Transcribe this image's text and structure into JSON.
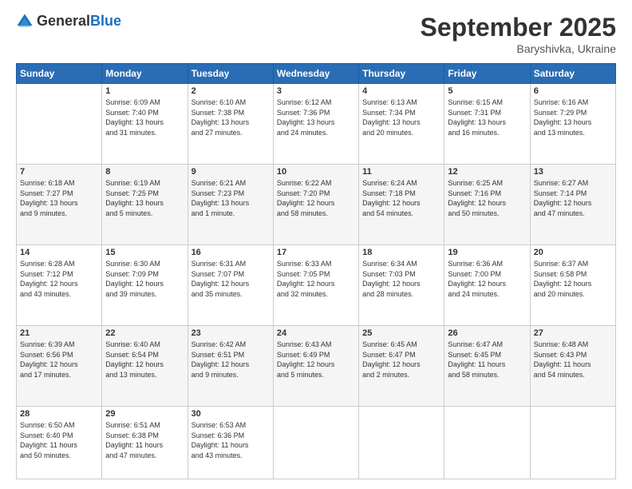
{
  "header": {
    "logo_general": "General",
    "logo_blue": "Blue",
    "month_title": "September 2025",
    "location": "Baryshivka, Ukraine"
  },
  "days_of_week": [
    "Sunday",
    "Monday",
    "Tuesday",
    "Wednesday",
    "Thursday",
    "Friday",
    "Saturday"
  ],
  "weeks": [
    [
      {
        "day": "",
        "content": ""
      },
      {
        "day": "1",
        "content": "Sunrise: 6:09 AM\nSunset: 7:40 PM\nDaylight: 13 hours\nand 31 minutes."
      },
      {
        "day": "2",
        "content": "Sunrise: 6:10 AM\nSunset: 7:38 PM\nDaylight: 13 hours\nand 27 minutes."
      },
      {
        "day": "3",
        "content": "Sunrise: 6:12 AM\nSunset: 7:36 PM\nDaylight: 13 hours\nand 24 minutes."
      },
      {
        "day": "4",
        "content": "Sunrise: 6:13 AM\nSunset: 7:34 PM\nDaylight: 13 hours\nand 20 minutes."
      },
      {
        "day": "5",
        "content": "Sunrise: 6:15 AM\nSunset: 7:31 PM\nDaylight: 13 hours\nand 16 minutes."
      },
      {
        "day": "6",
        "content": "Sunrise: 6:16 AM\nSunset: 7:29 PM\nDaylight: 13 hours\nand 13 minutes."
      }
    ],
    [
      {
        "day": "7",
        "content": "Sunrise: 6:18 AM\nSunset: 7:27 PM\nDaylight: 13 hours\nand 9 minutes."
      },
      {
        "day": "8",
        "content": "Sunrise: 6:19 AM\nSunset: 7:25 PM\nDaylight: 13 hours\nand 5 minutes."
      },
      {
        "day": "9",
        "content": "Sunrise: 6:21 AM\nSunset: 7:23 PM\nDaylight: 13 hours\nand 1 minute."
      },
      {
        "day": "10",
        "content": "Sunrise: 6:22 AM\nSunset: 7:20 PM\nDaylight: 12 hours\nand 58 minutes."
      },
      {
        "day": "11",
        "content": "Sunrise: 6:24 AM\nSunset: 7:18 PM\nDaylight: 12 hours\nand 54 minutes."
      },
      {
        "day": "12",
        "content": "Sunrise: 6:25 AM\nSunset: 7:16 PM\nDaylight: 12 hours\nand 50 minutes."
      },
      {
        "day": "13",
        "content": "Sunrise: 6:27 AM\nSunset: 7:14 PM\nDaylight: 12 hours\nand 47 minutes."
      }
    ],
    [
      {
        "day": "14",
        "content": "Sunrise: 6:28 AM\nSunset: 7:12 PM\nDaylight: 12 hours\nand 43 minutes."
      },
      {
        "day": "15",
        "content": "Sunrise: 6:30 AM\nSunset: 7:09 PM\nDaylight: 12 hours\nand 39 minutes."
      },
      {
        "day": "16",
        "content": "Sunrise: 6:31 AM\nSunset: 7:07 PM\nDaylight: 12 hours\nand 35 minutes."
      },
      {
        "day": "17",
        "content": "Sunrise: 6:33 AM\nSunset: 7:05 PM\nDaylight: 12 hours\nand 32 minutes."
      },
      {
        "day": "18",
        "content": "Sunrise: 6:34 AM\nSunset: 7:03 PM\nDaylight: 12 hours\nand 28 minutes."
      },
      {
        "day": "19",
        "content": "Sunrise: 6:36 AM\nSunset: 7:00 PM\nDaylight: 12 hours\nand 24 minutes."
      },
      {
        "day": "20",
        "content": "Sunrise: 6:37 AM\nSunset: 6:58 PM\nDaylight: 12 hours\nand 20 minutes."
      }
    ],
    [
      {
        "day": "21",
        "content": "Sunrise: 6:39 AM\nSunset: 6:56 PM\nDaylight: 12 hours\nand 17 minutes."
      },
      {
        "day": "22",
        "content": "Sunrise: 6:40 AM\nSunset: 6:54 PM\nDaylight: 12 hours\nand 13 minutes."
      },
      {
        "day": "23",
        "content": "Sunrise: 6:42 AM\nSunset: 6:51 PM\nDaylight: 12 hours\nand 9 minutes."
      },
      {
        "day": "24",
        "content": "Sunrise: 6:43 AM\nSunset: 6:49 PM\nDaylight: 12 hours\nand 5 minutes."
      },
      {
        "day": "25",
        "content": "Sunrise: 6:45 AM\nSunset: 6:47 PM\nDaylight: 12 hours\nand 2 minutes."
      },
      {
        "day": "26",
        "content": "Sunrise: 6:47 AM\nSunset: 6:45 PM\nDaylight: 11 hours\nand 58 minutes."
      },
      {
        "day": "27",
        "content": "Sunrise: 6:48 AM\nSunset: 6:43 PM\nDaylight: 11 hours\nand 54 minutes."
      }
    ],
    [
      {
        "day": "28",
        "content": "Sunrise: 6:50 AM\nSunset: 6:40 PM\nDaylight: 11 hours\nand 50 minutes."
      },
      {
        "day": "29",
        "content": "Sunrise: 6:51 AM\nSunset: 6:38 PM\nDaylight: 11 hours\nand 47 minutes."
      },
      {
        "day": "30",
        "content": "Sunrise: 6:53 AM\nSunset: 6:36 PM\nDaylight: 11 hours\nand 43 minutes."
      },
      {
        "day": "",
        "content": ""
      },
      {
        "day": "",
        "content": ""
      },
      {
        "day": "",
        "content": ""
      },
      {
        "day": "",
        "content": ""
      }
    ]
  ]
}
